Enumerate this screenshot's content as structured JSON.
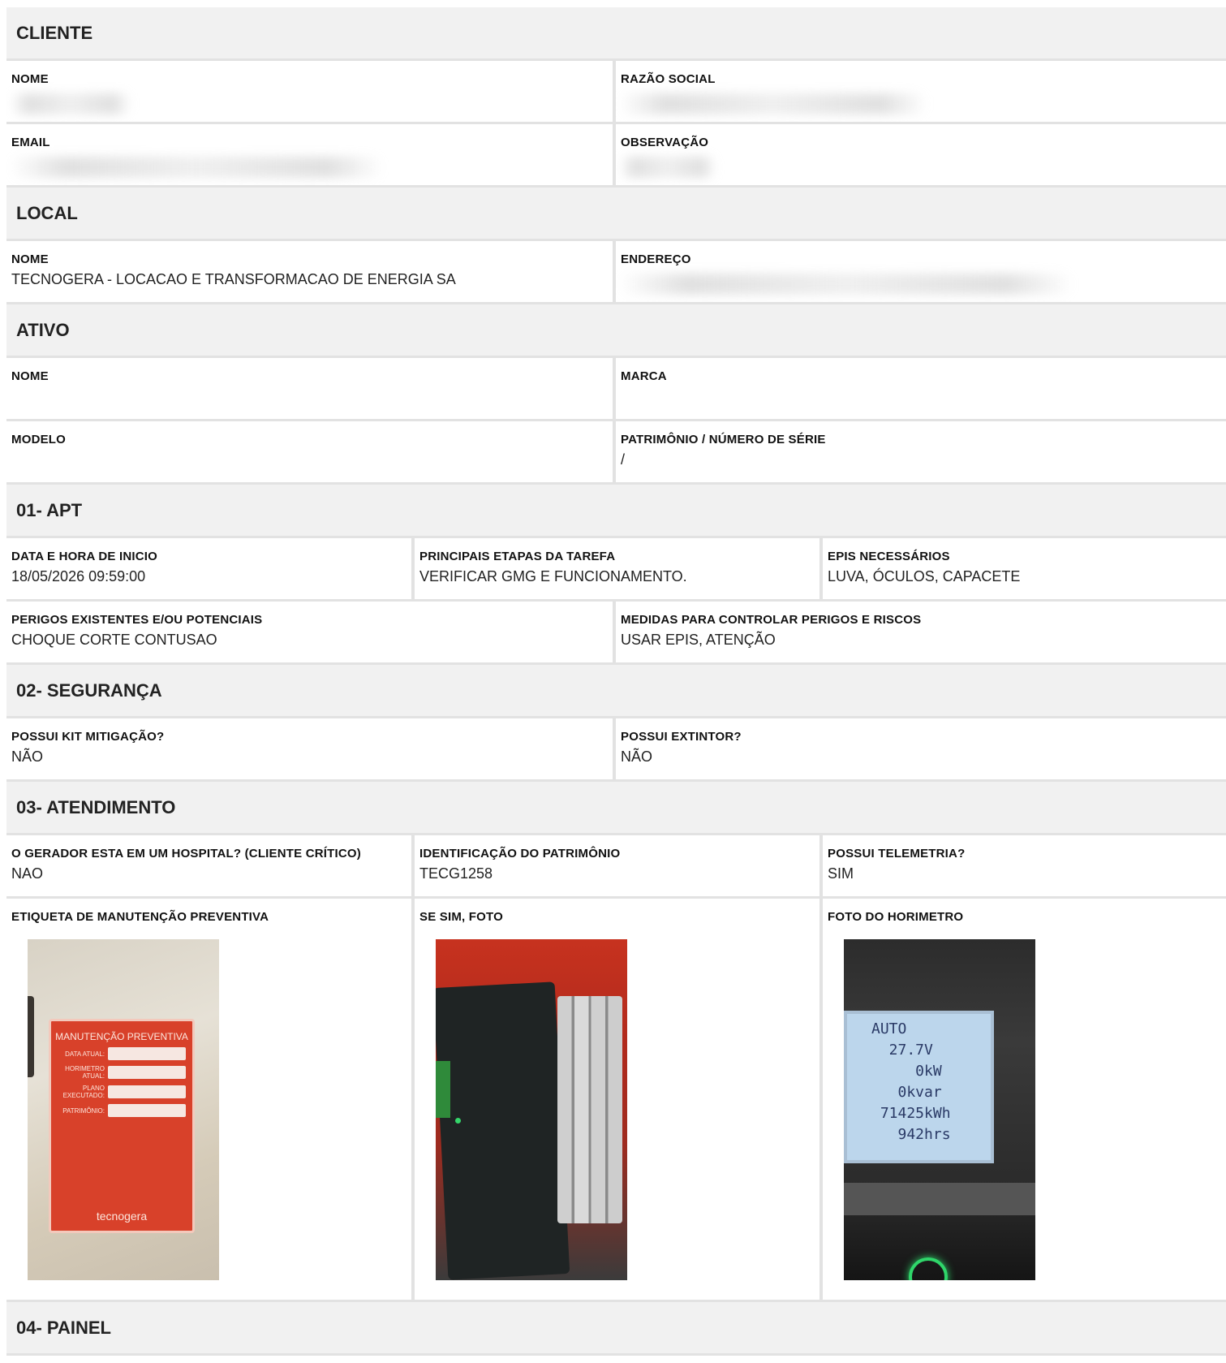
{
  "sections": {
    "cliente": "CLIENTE",
    "local": "LOCAL",
    "ativo": "ATIVO",
    "apt": "01- APT",
    "seguranca": "02- SEGURANÇA",
    "atendimento": "03- ATENDIMENTO",
    "painel": "04- PAINEL"
  },
  "cliente": {
    "nome_label": "NOME",
    "razao_label": "RAZÃO SOCIAL",
    "email_label": "EMAIL",
    "obs_label": "OBSERVAÇÃO"
  },
  "local": {
    "nome_label": "NOME",
    "nome_value": "TECNOGERA - LOCACAO E TRANSFORMACAO DE ENERGIA SA",
    "endereco_label": "ENDEREÇO"
  },
  "ativo": {
    "nome_label": "NOME",
    "marca_label": "MARCA",
    "modelo_label": "MODELO",
    "patrimonio_label": "PATRIMÔNIO / NÚMERO DE SÉRIE",
    "patrimonio_value": "/"
  },
  "apt": {
    "data_label": "DATA E HORA DE INICIO",
    "data_value": "18/05/2026 09:59:00",
    "etapas_label": "PRINCIPAIS ETAPAS DA TAREFA",
    "etapas_value": "VERIFICAR GMG E FUNCIONAMENTO.",
    "epis_label": "EPIS NECESSÁRIOS",
    "epis_value": "LUVA, ÓCULOS, CAPACETE",
    "perigos_label": "PERIGOS EXISTENTES E/OU POTENCIAIS",
    "perigos_value": "CHOQUE CORTE CONTUSAO",
    "medidas_label": "MEDIDAS PARA CONTROLAR PERIGOS E RISCOS",
    "medidas_value": "USAR EPIS, ATENÇÃO"
  },
  "seguranca": {
    "kit_label": "POSSUI KIT MITIGAÇÃO?",
    "kit_value": "NÃO",
    "extintor_label": "POSSUI EXTINTOR?",
    "extintor_value": "NÃO"
  },
  "atendimento": {
    "hospital_label": "O GERADOR ESTA EM UM HOSPITAL? (CLIENTE CRÍTICO)",
    "hospital_value": "NAO",
    "identificacao_label": "IDENTIFICAÇÃO DO PATRIMÔNIO",
    "identificacao_value": "TECG1258",
    "telemetria_label": "POSSUI TELEMETRIA?",
    "telemetria_value": "SIM",
    "etiqueta_label": "ETIQUETA DE MANUTENÇÃO PREVENTIVA",
    "foto_label": "SE SIM, FOTO",
    "horimetro_label": "FOTO DO HORIMETRO"
  },
  "photo_tag": {
    "title": "MANUTENÇÃO PREVENTIVA",
    "lines": [
      "DATA ATUAL:",
      "HORIMETRO ATUAL:",
      "PLANO EXECUTADO:",
      "PATRIMÔNIO:"
    ],
    "brand": "tecnogera"
  },
  "photo_display": {
    "line1": "AUTO",
    "line2": "  27.7V",
    "line3": "     0kW",
    "line4": "   0kvar",
    "line5": " 71425kWh",
    "line6": "   942hrs"
  }
}
